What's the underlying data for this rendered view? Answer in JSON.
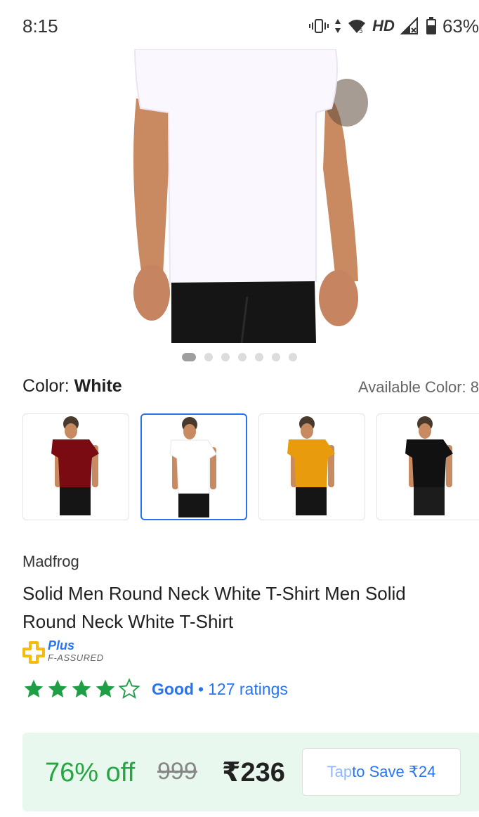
{
  "status": {
    "time": "8:15",
    "network": "HD",
    "battery": "63%",
    "icons": [
      "vibrate-icon",
      "data-arrows-icon",
      "wifi-icon",
      "signal-icon",
      "battery-icon"
    ]
  },
  "gallery": {
    "image_icon": "white-tshirt-photo",
    "dots_total": 7,
    "dots_active": 0
  },
  "color": {
    "label": "Color:",
    "value": "White",
    "available": "Available Color: 8",
    "swatches": [
      {
        "name": "Maroon",
        "hex": "#7b0b12",
        "selected": false
      },
      {
        "name": "White",
        "hex": "#ffffff",
        "selected": true
      },
      {
        "name": "Mustard",
        "hex": "#e89b0c",
        "selected": false
      },
      {
        "name": "Black",
        "hex": "#111111",
        "selected": false
      }
    ]
  },
  "product": {
    "brand": "Madfrog",
    "title": "Solid Men Round Neck White T-Shirt Men Solid Round Neck White T-Shirt",
    "assured_top": "Plus",
    "assured_bottom": "F-ASSURED",
    "rating_stars": 4,
    "rating_max": 5,
    "rating_word": "Good",
    "rating_separator": "•",
    "rating_count": "127 ratings"
  },
  "price": {
    "discount": "76% off",
    "mrp": "999",
    "selling": "₹236",
    "save_prefix": "Tap",
    "save_rest": " to Save ₹24"
  },
  "colors": {
    "accent": "#2874f0",
    "green": "#26a541",
    "price_bg": "#e8f8ee",
    "star": "#1e9e45"
  }
}
